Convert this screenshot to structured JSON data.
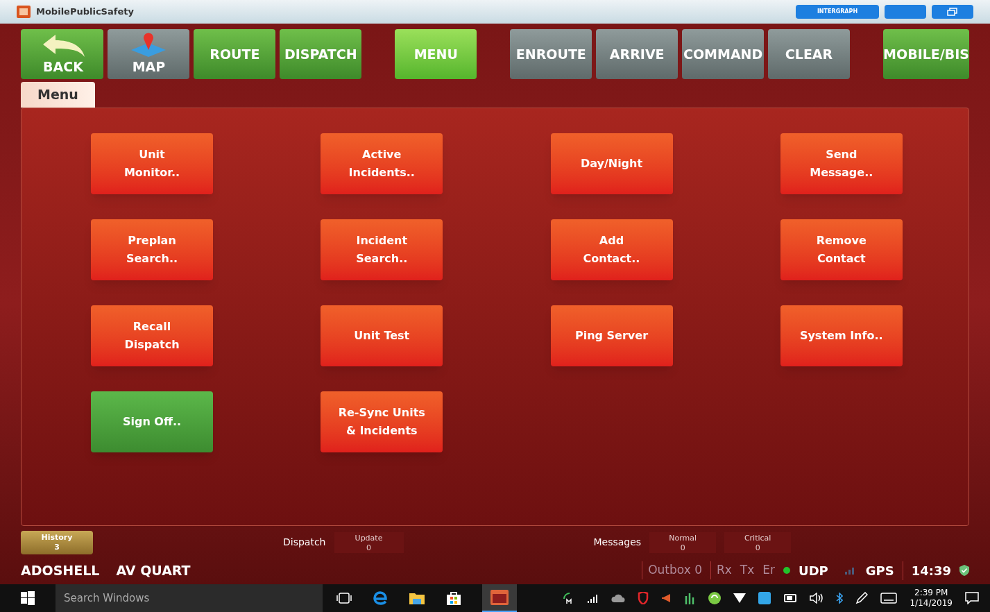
{
  "window": {
    "title": "MobilePublicSafety",
    "header_buttons": [
      {
        "label": "INTERGRAPH"
      }
    ]
  },
  "toolbar": [
    {
      "label": "BACK",
      "kind": "green"
    },
    {
      "label": "MAP",
      "kind": "gray"
    },
    {
      "label": "ROUTE",
      "kind": "green"
    },
    {
      "label": "DISPATCH",
      "kind": "green"
    },
    {
      "label": "MENU",
      "kind": "bright"
    },
    {
      "label": "ENROUTE",
      "kind": "gray"
    },
    {
      "label": "ARRIVE",
      "kind": "gray"
    },
    {
      "label": "COMMAND",
      "kind": "gray"
    },
    {
      "label": "CLEAR",
      "kind": "gray"
    },
    {
      "label": "MOBILE/BIS",
      "kind": "green"
    }
  ],
  "tab": {
    "label": "Menu"
  },
  "menu_buttons": [
    {
      "label": "Unit\nMonitor..",
      "kind": "red"
    },
    {
      "label": "Active\nIncidents..",
      "kind": "red"
    },
    {
      "label": "Day/Night",
      "kind": "red"
    },
    {
      "label": "Send\nMessage..",
      "kind": "red"
    },
    {
      "label": "Preplan\nSearch..",
      "kind": "red"
    },
    {
      "label": "Incident\nSearch..",
      "kind": "red"
    },
    {
      "label": "Add\nContact..",
      "kind": "red"
    },
    {
      "label": "Remove\nContact",
      "kind": "red"
    },
    {
      "label": "Recall\nDispatch",
      "kind": "red"
    },
    {
      "label": "Unit Test",
      "kind": "red"
    },
    {
      "label": "Ping Server",
      "kind": "red"
    },
    {
      "label": "System Info..",
      "kind": "red"
    },
    {
      "label": "Sign Off..",
      "kind": "green"
    },
    {
      "label": "Re-Sync Units\n& Incidents",
      "kind": "red"
    }
  ],
  "status": {
    "history": {
      "label": "History",
      "count": "3"
    },
    "dispatch_label": "Dispatch",
    "update": {
      "label": "Update",
      "count": "0"
    },
    "messages_label": "Messages",
    "normal": {
      "label": "Normal",
      "count": "0"
    },
    "critical": {
      "label": "Critical",
      "count": "0"
    },
    "unit": "ADOSHELL",
    "station": "AV QUART",
    "outbox": "Outbox 0",
    "rx": "Rx",
    "tx": "Tx",
    "er": "Er",
    "udp": "UDP",
    "udp_on": true,
    "gps": "GPS",
    "clock": "14:39"
  },
  "taskbar": {
    "search_placeholder": "Search Windows",
    "time": "2:39 PM",
    "date": "1/14/2019"
  }
}
